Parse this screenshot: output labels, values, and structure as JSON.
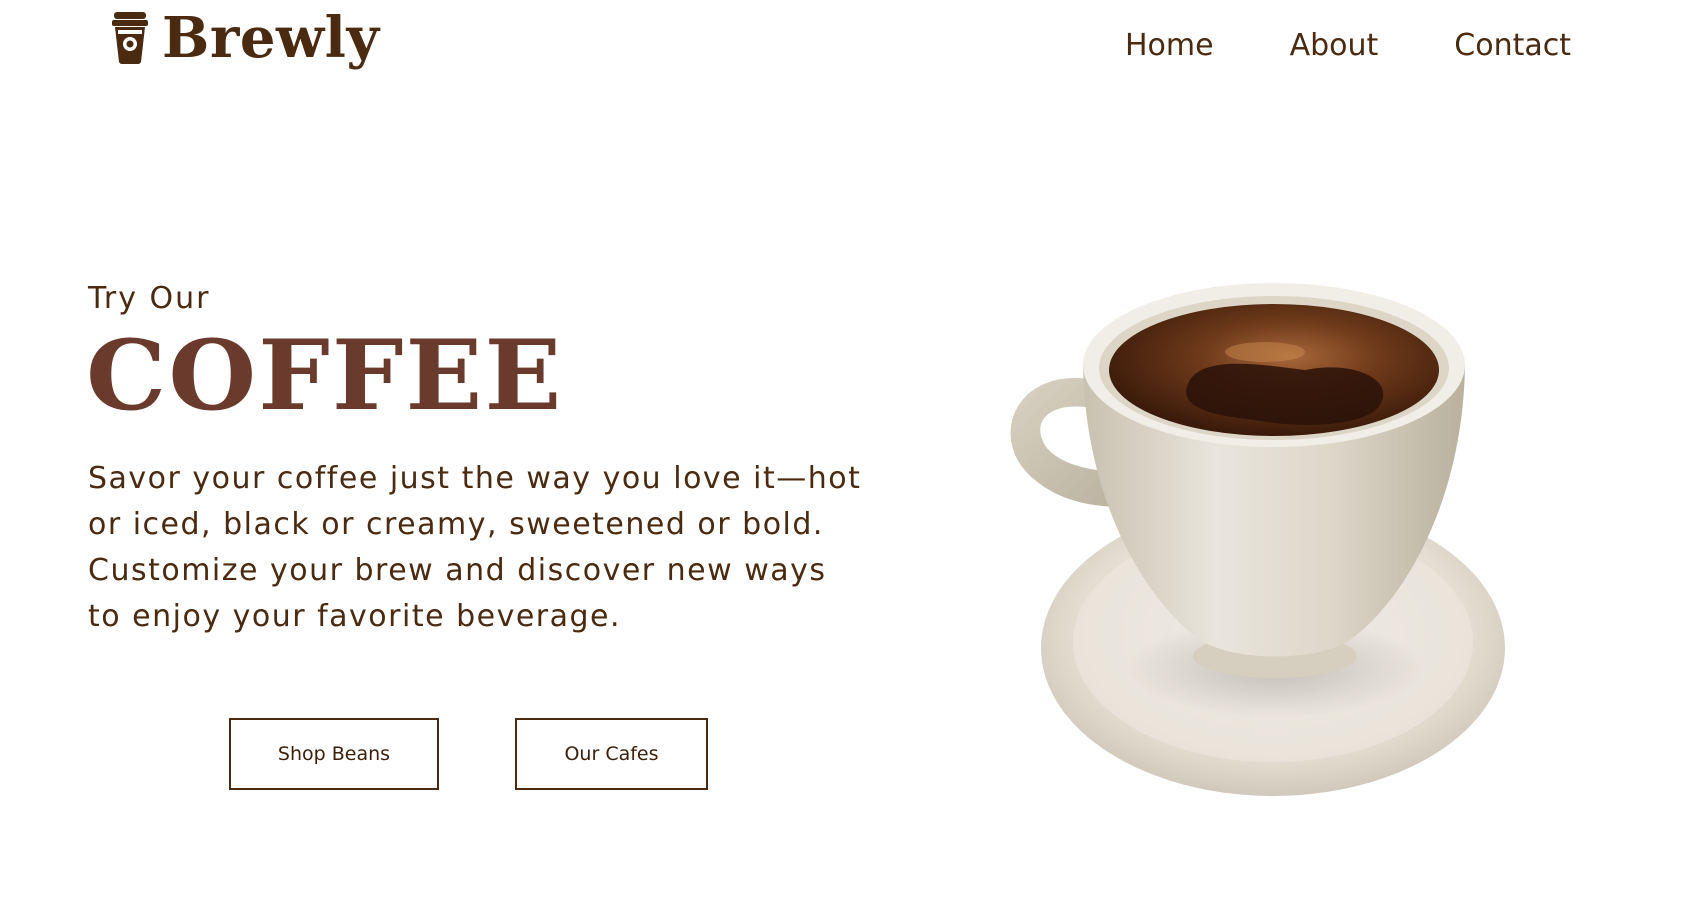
{
  "brand": {
    "name": "Brewly",
    "icon": "coffee-cup-icon",
    "color": "#4a2a10"
  },
  "nav": {
    "items": [
      {
        "label": "Home"
      },
      {
        "label": "About"
      },
      {
        "label": "Contact"
      }
    ]
  },
  "hero": {
    "eyebrow": "Try Our",
    "title": "COFFEE",
    "title_color": "#6a3b2c",
    "description": "Savor your coffee just the way you love it—hot or iced, black or creamy, sweetened or bold. Customize your brew and discover new ways to enjoy your favorite beverage.",
    "buttons": {
      "shop_label": "Shop Beans",
      "cafes_label": "Our Cafes"
    },
    "image": "coffee-cup-on-saucer"
  }
}
